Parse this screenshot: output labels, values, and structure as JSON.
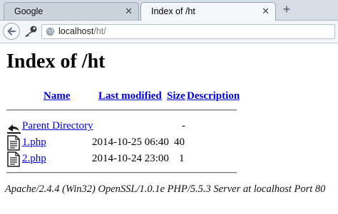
{
  "browser": {
    "tabs": [
      {
        "title": "Google",
        "close": "✕"
      },
      {
        "title": "Index of /ht",
        "close": "✕"
      }
    ],
    "new_tab": "+",
    "url": {
      "host": "localhost",
      "path": "/ht/"
    }
  },
  "page": {
    "heading": "Index of /ht",
    "columns": [
      "Name",
      "Last modified",
      "Size",
      "Description"
    ],
    "rows": [
      {
        "name": "Parent Directory",
        "modified": "",
        "size": "-",
        "icon": "back-folder-icon"
      },
      {
        "name": "1.php",
        "modified": "2014-10-25 06:40",
        "size": "40",
        "icon": "document-icon"
      },
      {
        "name": "2.php",
        "modified": "2014-10-24 23:00",
        "size": "1",
        "icon": "document-icon"
      }
    ],
    "address": "Apache/2.4.4 (Win32) OpenSSL/1.0.1e PHP/5.5.3 Server at localhost Port 80"
  },
  "colors": {
    "link": "#0000cc",
    "tabbar": "#d6dde6"
  }
}
